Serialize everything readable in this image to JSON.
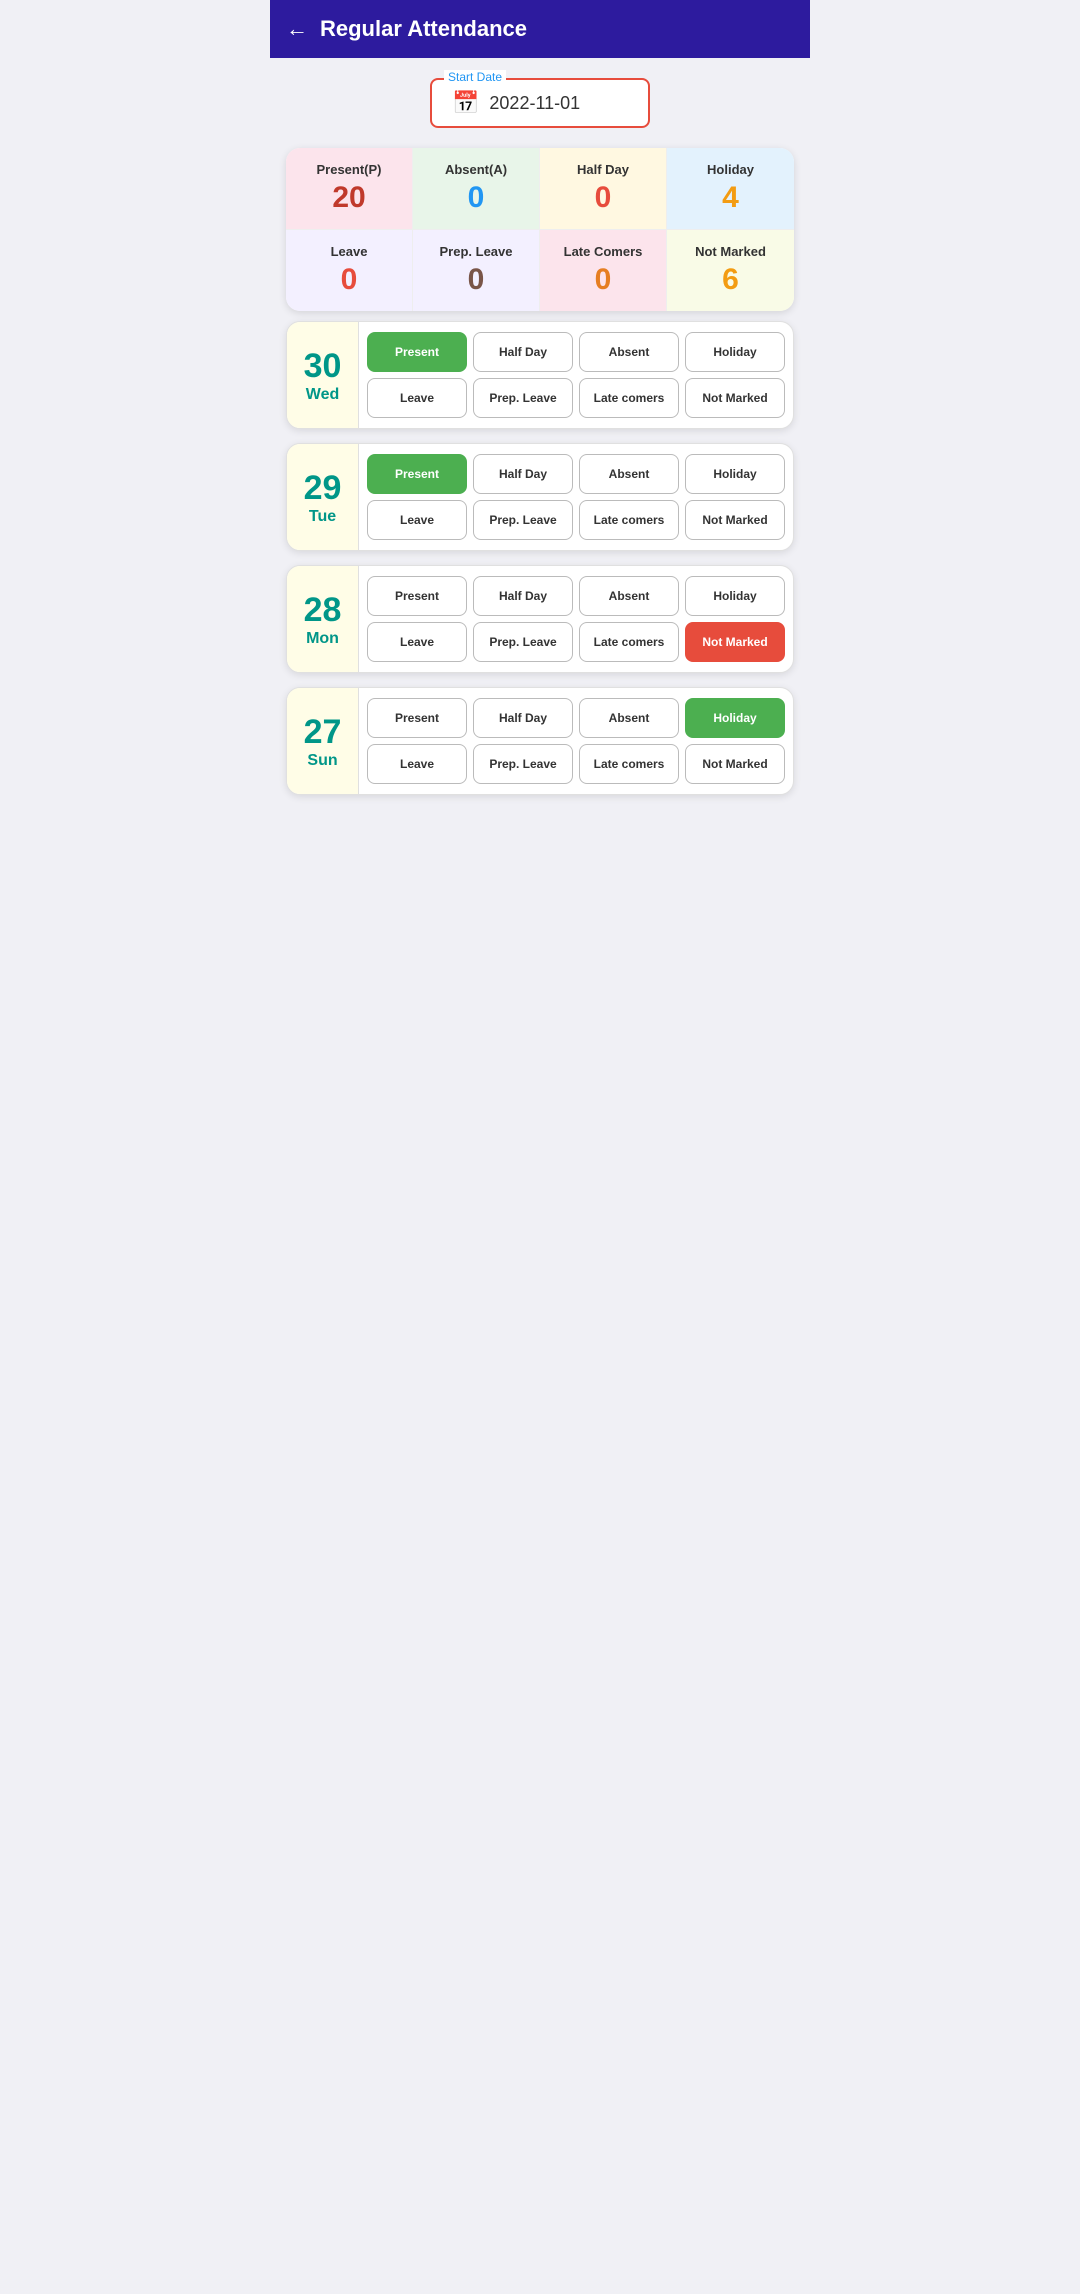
{
  "header": {
    "title": "Regular Attendance",
    "back_label": "←"
  },
  "date_picker": {
    "label": "Start Date",
    "value": "2022-11-01",
    "icon": "📅"
  },
  "summary": {
    "top_row": [
      {
        "label": "Present(P)",
        "value": "20",
        "bg": "present-bg",
        "val_class": "val-present"
      },
      {
        "label": "Absent(A)",
        "value": "0",
        "bg": "absent-bg",
        "val_class": "val-absent"
      },
      {
        "label": "Half Day",
        "value": "0",
        "bg": "halfday-bg",
        "val_class": "val-halfday"
      },
      {
        "label": "Holiday",
        "value": "4",
        "bg": "holiday-bg",
        "val_class": "val-holiday"
      }
    ],
    "bottom_row": [
      {
        "label": "Leave",
        "value": "0",
        "bg": "leave-bg",
        "val_class": "val-leave"
      },
      {
        "label": "Prep. Leave",
        "value": "0",
        "bg": "prepleave-bg",
        "val_class": "val-prepleave"
      },
      {
        "label": "Late Comers",
        "value": "0",
        "bg": "latecomers-bg",
        "val_class": "val-latecomers"
      },
      {
        "label": "Not Marked",
        "value": "6",
        "bg": "notmarked-bg",
        "val_class": "val-notmarked"
      }
    ]
  },
  "days": [
    {
      "number": "30",
      "name": "Wed",
      "buttons": [
        {
          "label": "Present",
          "active": "active-present"
        },
        {
          "label": "Half Day",
          "active": ""
        },
        {
          "label": "Absent",
          "active": ""
        },
        {
          "label": "Holiday",
          "active": ""
        },
        {
          "label": "Leave",
          "active": ""
        },
        {
          "label": "Prep. Leave",
          "active": ""
        },
        {
          "label": "Late comers",
          "active": ""
        },
        {
          "label": "Not Marked",
          "active": ""
        }
      ]
    },
    {
      "number": "29",
      "name": "Tue",
      "buttons": [
        {
          "label": "Present",
          "active": "active-present"
        },
        {
          "label": "Half Day",
          "active": ""
        },
        {
          "label": "Absent",
          "active": ""
        },
        {
          "label": "Holiday",
          "active": ""
        },
        {
          "label": "Leave",
          "active": ""
        },
        {
          "label": "Prep. Leave",
          "active": ""
        },
        {
          "label": "Late comers",
          "active": ""
        },
        {
          "label": "Not Marked",
          "active": ""
        }
      ]
    },
    {
      "number": "28",
      "name": "Mon",
      "buttons": [
        {
          "label": "Present",
          "active": ""
        },
        {
          "label": "Half Day",
          "active": ""
        },
        {
          "label": "Absent",
          "active": ""
        },
        {
          "label": "Holiday",
          "active": ""
        },
        {
          "label": "Leave",
          "active": ""
        },
        {
          "label": "Prep. Leave",
          "active": ""
        },
        {
          "label": "Late comers",
          "active": ""
        },
        {
          "label": "Not Marked",
          "active": "active-notmarked"
        }
      ]
    },
    {
      "number": "27",
      "name": "Sun",
      "buttons": [
        {
          "label": "Present",
          "active": ""
        },
        {
          "label": "Half Day",
          "active": ""
        },
        {
          "label": "Absent",
          "active": ""
        },
        {
          "label": "Holiday",
          "active": "active-holiday"
        },
        {
          "label": "Leave",
          "active": ""
        },
        {
          "label": "Prep. Leave",
          "active": ""
        },
        {
          "label": "Late comers",
          "active": ""
        },
        {
          "label": "Not Marked",
          "active": ""
        }
      ]
    }
  ]
}
